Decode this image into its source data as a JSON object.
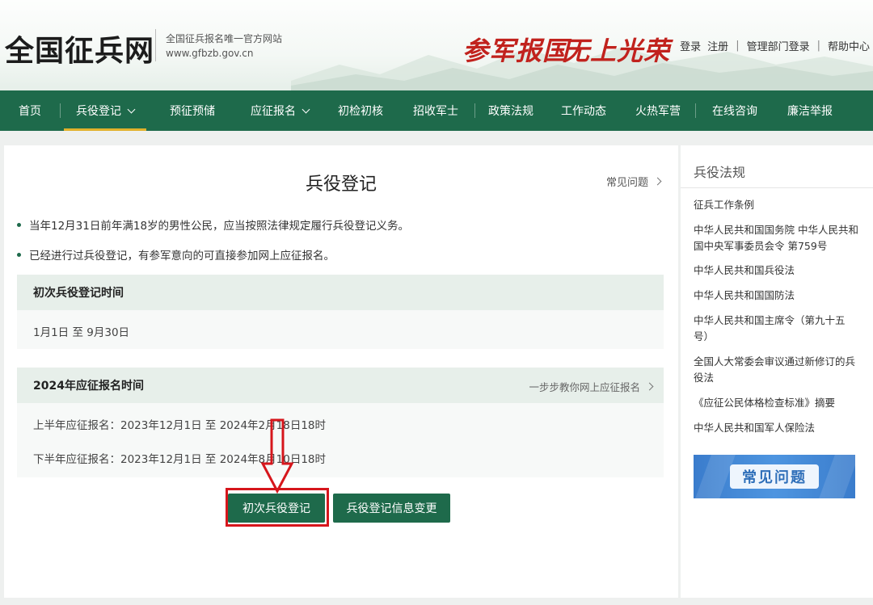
{
  "header": {
    "logo": "全国征兵网",
    "slogan_line1": "全国征兵报名唯一官方网站",
    "slogan_line2": "www.gfbzb.gov.cn",
    "motto1": "参军报国",
    "motto2": "无上光荣",
    "links": {
      "login": "登录",
      "register": "注册",
      "admin_login": "管理部门登录",
      "help": "帮助中心"
    }
  },
  "nav": {
    "items": [
      {
        "label": "首页"
      },
      {
        "label": "兵役登记"
      },
      {
        "label": "预征预储"
      },
      {
        "label": "应征报名"
      },
      {
        "label": "初检初核"
      },
      {
        "label": "招收军士"
      },
      {
        "label": "政策法规"
      },
      {
        "label": "工作动态"
      },
      {
        "label": "火热军营"
      },
      {
        "label": "在线咨询"
      },
      {
        "label": "廉洁举报"
      }
    ],
    "active_color": "#e1b12b",
    "bg_color": "#1e6a4b"
  },
  "main": {
    "title": "兵役登记",
    "faq_link": "常见问题",
    "bullets": [
      "当年12月31日前年满18岁的男性公民，应当按照法律规定履行兵役登记义务。",
      "已经进行过兵役登记，有参军意向的可直接参加网上应征报名。"
    ],
    "first_registration": {
      "heading": "初次兵役登记时间",
      "period": "1月1日 至 9月30日"
    },
    "enlistment": {
      "heading": "2024年应征报名时间",
      "guide_link": "一步步教你网上应征报名",
      "first_half": "上半年应征报名：2023年12月1日 至 2024年2月18日18时",
      "second_half": "下半年应征报名：2023年12月1日 至 2024年8月10日18时"
    },
    "buttons": {
      "first_registration": "初次兵役登记",
      "info_change": "兵役登记信息变更"
    }
  },
  "sidebar": {
    "title": "兵役法规",
    "items": [
      "征兵工作条例",
      "中华人民共和国国务院 中华人民共和国中央军事委员会令 第759号",
      "中华人民共和国兵役法",
      "中华人民共和国国防法",
      "中华人民共和国主席令（第九十五号）",
      "全国人大常委会审议通过新修订的兵役法",
      "《应征公民体格检查标准》摘要",
      "中华人民共和国军人保险法"
    ],
    "banner_label": "常见问题"
  },
  "colors": {
    "brand_green": "#1e6a4b",
    "highlight_red": "#d6161c",
    "motto_red": "#c1221d"
  }
}
